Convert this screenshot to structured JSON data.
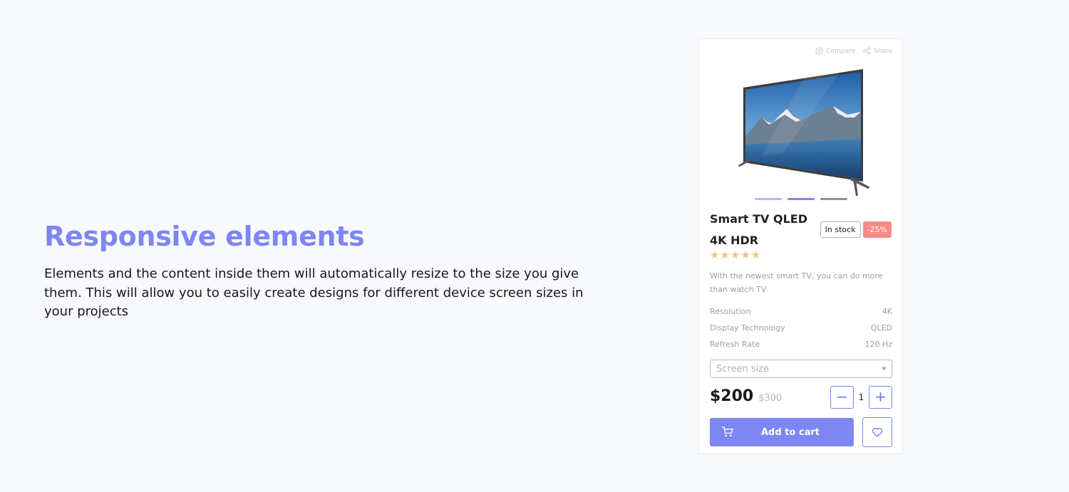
{
  "intro": {
    "heading": "Responsive elements",
    "body": "Elements and the content inside them will automatically resize to the size you give them. This will allow you to easily create designs for different device screen sizes in your projects"
  },
  "card": {
    "compare_label": "Compare",
    "share_label": "Share",
    "gallery": {
      "slide_count": 3,
      "active_index": 1
    },
    "title": "Smart TV QLED 4K HDR",
    "stock_badge": "In stock",
    "discount_badge": "-25%",
    "rating": {
      "stars": 5,
      "max": 5
    },
    "description": "With the newest smart TV, you can do more than watch TV",
    "specs": [
      {
        "label": "Resolution",
        "value": "4K"
      },
      {
        "label": "Display Technology",
        "value": "QLED"
      },
      {
        "label": "Refresh Rate",
        "value": "120 Hz"
      }
    ],
    "size_select_placeholder": "Screen size",
    "price_current": "$200",
    "price_old": "$300",
    "quantity": "1",
    "decrement_symbol": "−",
    "increment_symbol": "+",
    "add_to_cart_label": "Add to cart"
  },
  "colors": {
    "accent": "#7d86f2",
    "discount": "#f88a87",
    "star": "#f4c27a",
    "background": "#f8f9fc"
  }
}
